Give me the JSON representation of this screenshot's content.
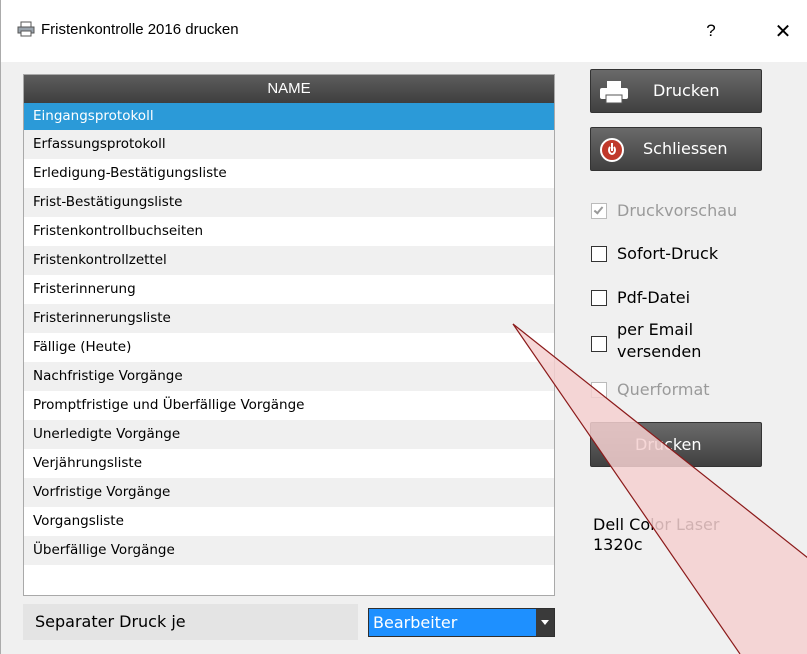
{
  "window": {
    "title": "Fristenkontrolle 2016 drucken",
    "help_label": "?",
    "close_label": "✕"
  },
  "list": {
    "header": "NAME",
    "items": [
      "Eingangsprotokoll",
      "Erfassungsprotokoll",
      "Erledigung-Bestätigungsliste",
      "Frist-Bestätigungsliste",
      "Fristenkontrollbuchseiten",
      "Fristenkontrollzettel",
      "Fristerinnerung",
      "Fristerinnerungsliste",
      "Fällige (Heute)",
      "Nachfristige Vorgänge",
      "Promptfristige und Überfällige Vorgänge",
      "Unerledigte Vorgänge",
      "Verjährungsliste",
      "Vorfristige Vorgänge",
      "Vorgangsliste",
      "Überfällige Vorgänge"
    ],
    "selected_index": 0
  },
  "separate": {
    "label": "Separater Druck je",
    "value": "Bearbeiter"
  },
  "actions": {
    "print_label": "Drucken",
    "close_label": "Schliessen",
    "print2_label": "Drucken"
  },
  "options": {
    "preview": {
      "label": "Druckvorschau",
      "checked": true,
      "enabled": false
    },
    "instant": {
      "label": "Sofort-Druck",
      "checked": false,
      "enabled": true
    },
    "pdf": {
      "label": "Pdf-Datei",
      "checked": false,
      "enabled": true
    },
    "email_line1": "per Email",
    "email_line2": "versenden",
    "landscape": {
      "label": "Querformat",
      "checked": false,
      "enabled": false
    }
  },
  "printer": {
    "line1": "Dell Color Laser",
    "line2": "1320c"
  },
  "colors": {
    "selection": "#2b9ad8",
    "combo": "#1e90ff",
    "button_dark": "#4a4a4a",
    "overlay_fill": "#f4d0d0",
    "overlay_stroke": "#8b1a1a"
  }
}
